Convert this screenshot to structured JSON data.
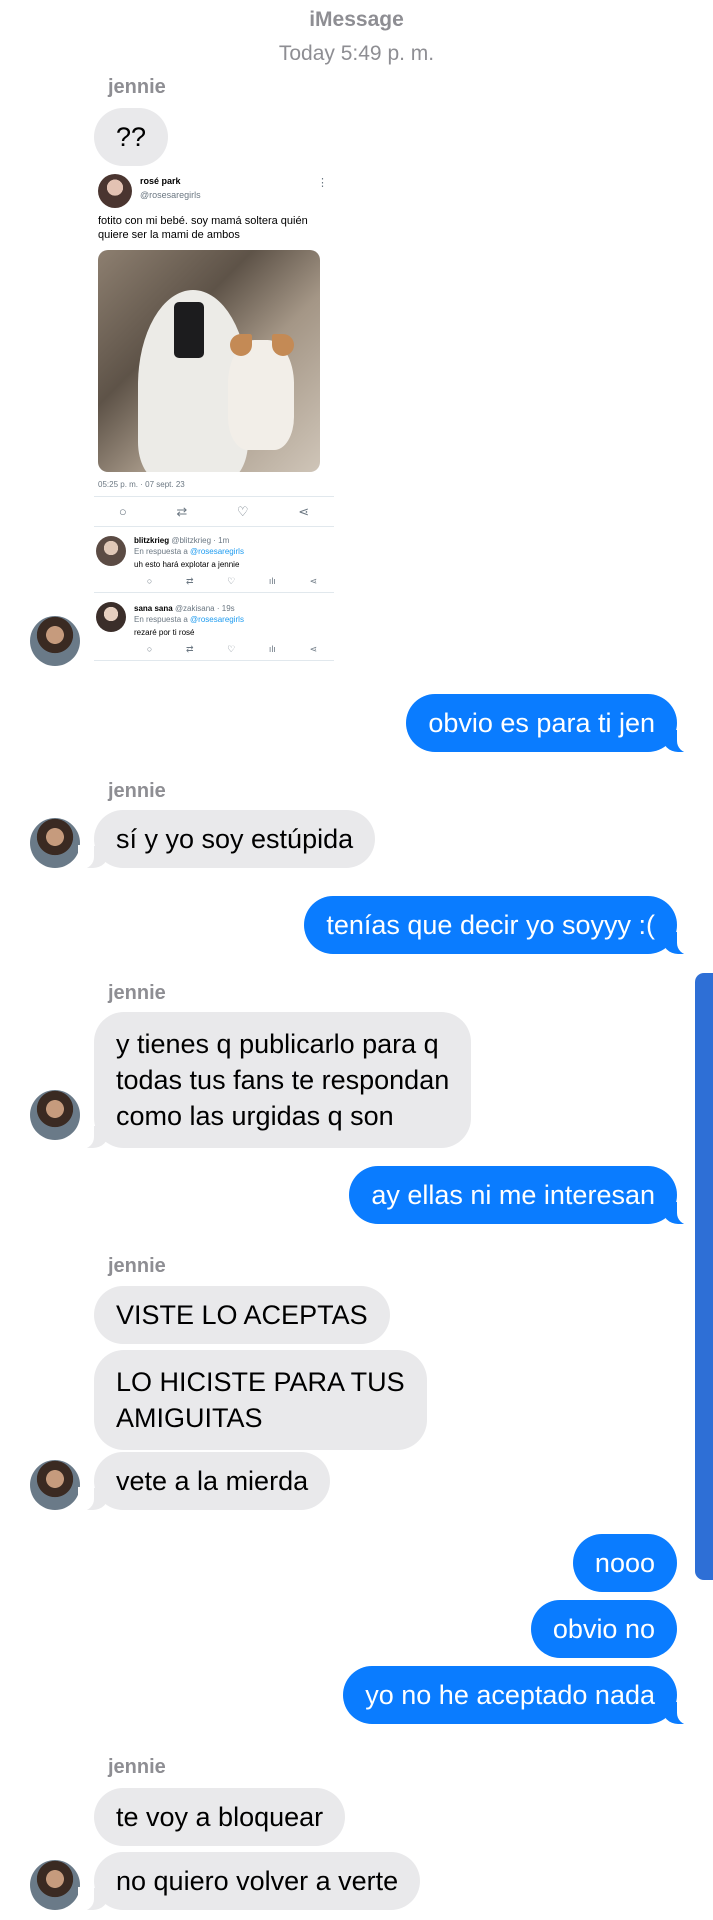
{
  "header": {
    "service": "iMessage",
    "timestamp": "Today 5:49 p. m."
  },
  "contact_name": "jennie",
  "tweet": {
    "author_name": "rosé park",
    "author_handle": "@rosesaregirls",
    "text": "fotito con mi bebé. soy mamá soltera quién quiere ser la mami de ambos",
    "date": "05:25 p. m. · 07 sept. 23",
    "replies": [
      {
        "name": "blitzkrieg",
        "handle": "@blitzkrieg · 1m",
        "reply_prefix": "En respuesta a",
        "reply_to": "@rosesaregirls",
        "text": "uh esto hará explotar a jennie"
      },
      {
        "name": "sana sana",
        "handle": "@zakisana · 19s",
        "reply_prefix": "En respuesta a",
        "reply_to": "@rosesaregirls",
        "text": "rezaré por ti rosé"
      }
    ]
  },
  "messages": {
    "m1": "??",
    "m2": "obvio es para ti jen",
    "m3": "sí y yo soy estúpida",
    "m4": "tenías que decir yo soyyy :(",
    "m5_l1": "y tienes q publicarlo para q",
    "m5_l2": "todas tus fans te respondan",
    "m5_l3": "como las urgidas q son",
    "m6": "ay ellas ni me interesan",
    "m7": "VISTE LO ACEPTAS",
    "m8_l1": "LO HICISTE PARA TUS",
    "m8_l2": "AMIGUITAS",
    "m9": "vete a la mierda",
    "m10": "nooo",
    "m11": "obvio no",
    "m12": "yo no he aceptado nada",
    "m13": "te voy a bloquear",
    "m14": "no quiero volver a verte"
  },
  "colors": {
    "incoming": "#e9e9eb",
    "outgoing": "#0a7cff",
    "scrollbar": "#2e6fd6"
  }
}
